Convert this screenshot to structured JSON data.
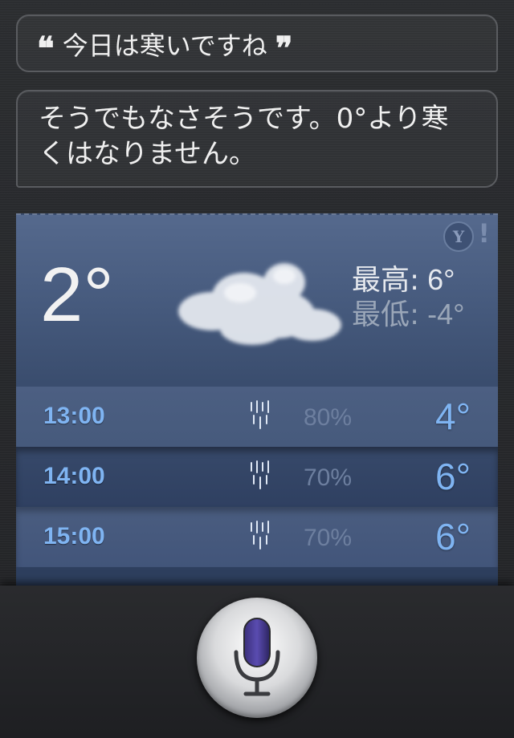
{
  "conversation": {
    "user_query": "今日は寒いですね",
    "open_quote": "❝",
    "close_quote": "❞",
    "siri_response": "そうでもなさそうです。0°より寒くはなりません。"
  },
  "weather": {
    "current_temp": "2°",
    "condition_icon": "cloud-icon",
    "high_label": "最高:",
    "high_value": "6°",
    "low_label": "最低:",
    "low_value": "-4°",
    "provider_icon": "yahoo-icon",
    "provider_text": "Y",
    "provider_bang": "!",
    "hourly": [
      {
        "time": "13:00",
        "icon": "rain-icon",
        "precip": "80%",
        "temp": "4°"
      },
      {
        "time": "14:00",
        "icon": "rain-icon",
        "precip": "70%",
        "temp": "6°"
      },
      {
        "time": "15:00",
        "icon": "rain-icon",
        "precip": "70%",
        "temp": "6°"
      }
    ]
  },
  "controls": {
    "mic_button": "microphone-icon"
  },
  "colors": {
    "accent_blue": "#7fb4f2",
    "card_bg": "#45597c",
    "background": "#28292c"
  }
}
